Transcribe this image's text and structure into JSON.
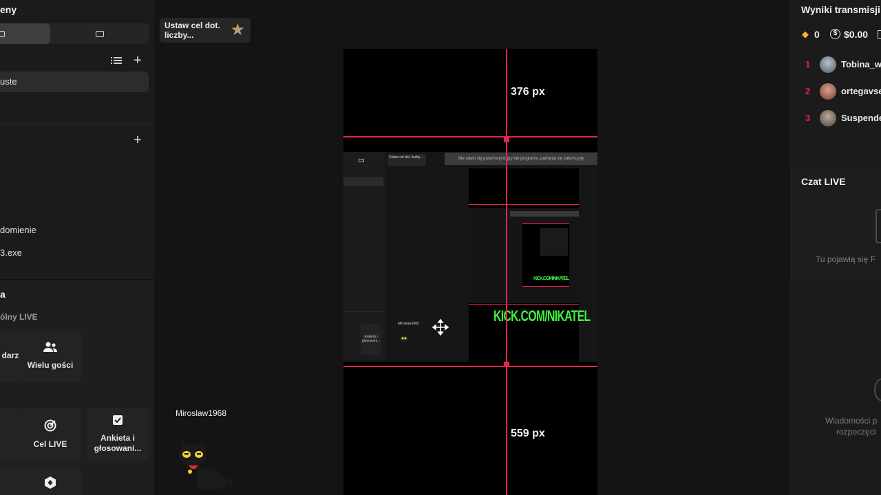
{
  "left_panel": {
    "title_fragment": "eny",
    "section1_item_selected": "uste",
    "items": [
      "domienie",
      "3.exe"
    ],
    "section2_title_fragment": "a",
    "subtitle": "ólny LIVE",
    "tiles": [
      {
        "label": "darz",
        "icon": "calendar-icon"
      },
      {
        "label": "Wielu gości",
        "icon": "guests-icon"
      },
      {
        "label": "Cel LIVE",
        "icon": "target-icon"
      },
      {
        "label": "Ankieta i głosowani...",
        "icon": "poll-icon"
      },
      {
        "label": "",
        "icon": "diamond-badge-icon"
      }
    ]
  },
  "goal_chip": {
    "label": "Ustaw cel dot. liczby..."
  },
  "stream_overlay": {
    "username": "Miroslaw1968"
  },
  "preview": {
    "top_distance": "376 px",
    "bottom_distance": "559 px",
    "inner_bar_text": "Nie udało się przechwycić gry lub programu, pamiętaj się zakończyły",
    "inner_goal_text": "Ustaw cel dot. liczby...",
    "inner_username": "Miroslaw1965",
    "kick_text_large": "KICK.COM/NIKATEL",
    "kick_text_small": "KICK.COM/NIKATEL",
    "inner_tile_label": "Ankieta i głosowani..."
  },
  "right_panel": {
    "results_title": "Wyniki transmisji L",
    "diamonds": "0",
    "earnings": "$0.00",
    "leaderboard": [
      {
        "rank": "1",
        "name": "Tobina_w"
      },
      {
        "rank": "2",
        "name": "ortegavse"
      },
      {
        "rank": "3",
        "name": "Suspende"
      }
    ],
    "chat_title": "Czat LIVE",
    "chat_empty": "Tu pojawią się F",
    "messages_empty_line1": "Wiadomości p",
    "messages_empty_line2": "rozpoczęci"
  },
  "colors": {
    "accent": "#e4244b",
    "kick_green": "#3ef23e"
  }
}
